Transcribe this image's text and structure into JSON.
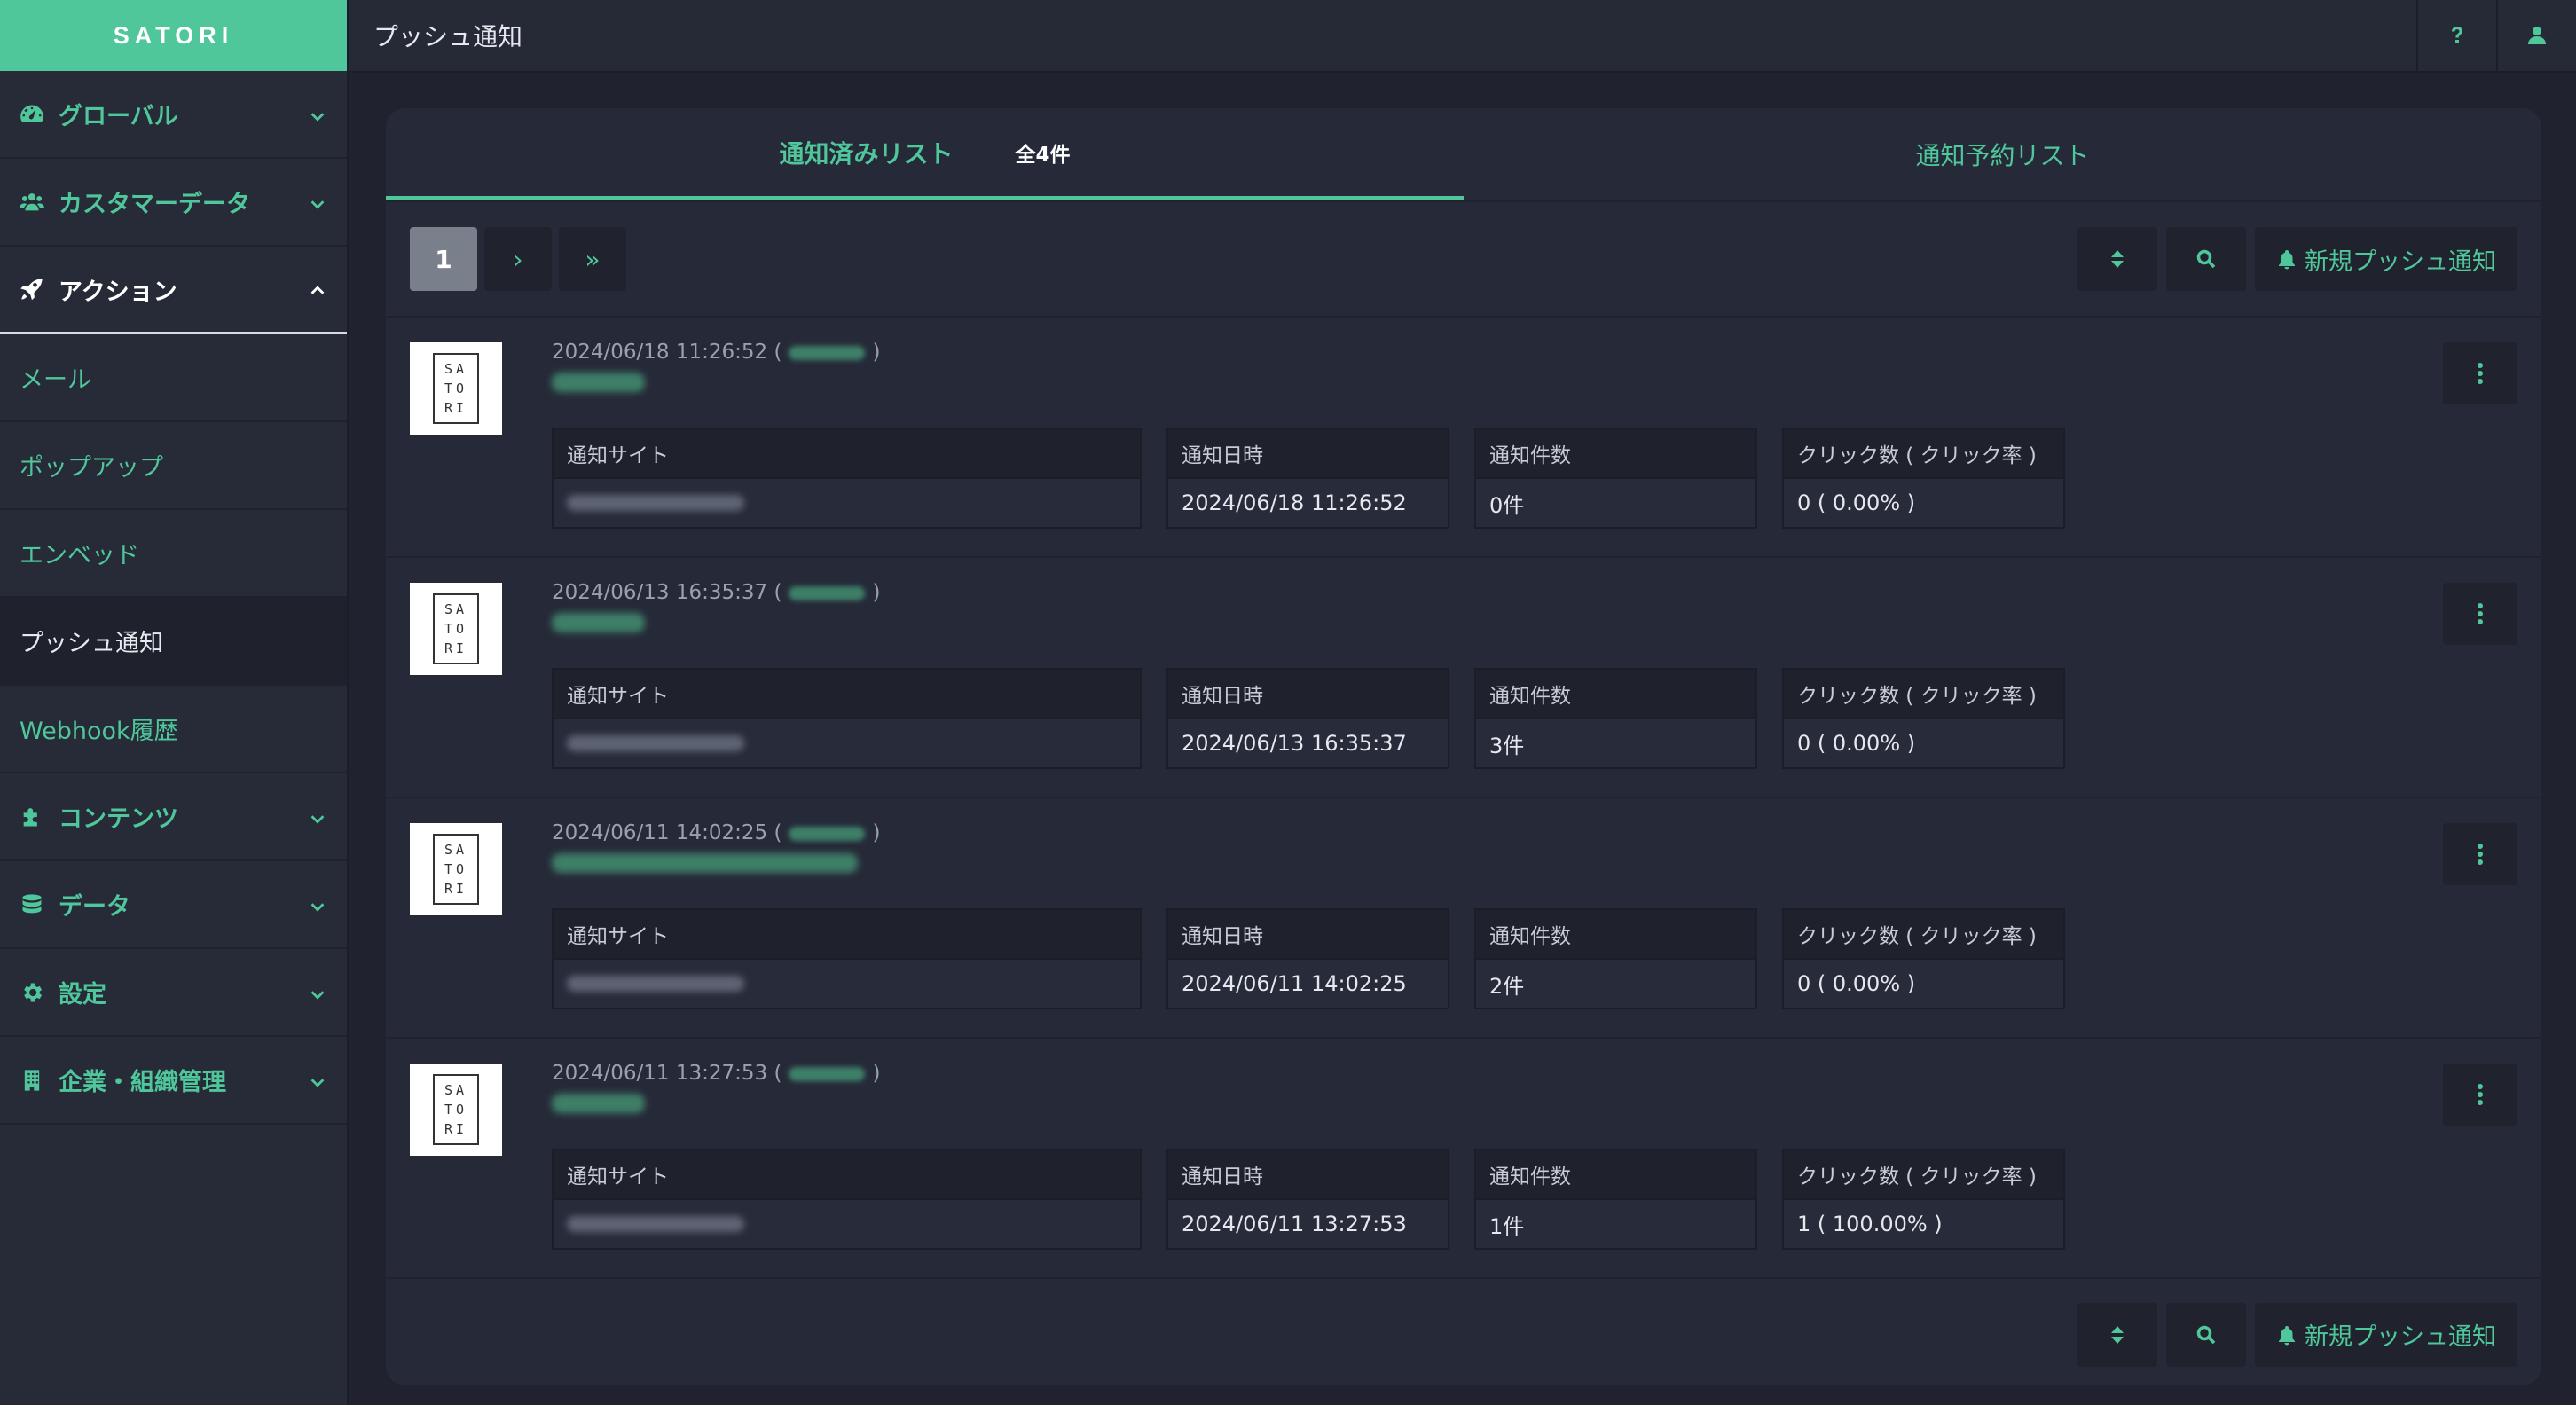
{
  "app": {
    "brand": "SATORI",
    "page_title": "プッシュ通知"
  },
  "sidebar": {
    "items": [
      {
        "key": "global",
        "label": "グローバル",
        "icon": "dashboard-icon"
      },
      {
        "key": "customer",
        "label": "カスタマーデータ",
        "icon": "users-icon"
      },
      {
        "key": "action",
        "label": "アクション",
        "icon": "rocket-icon",
        "open": true
      }
    ],
    "sub_items": [
      "メール",
      "ポップアップ",
      "エンベッド",
      "プッシュ通知",
      "Webhook履歴"
    ],
    "active_sub": "プッシュ通知",
    "more_items": [
      {
        "key": "contents",
        "label": "コンテンツ",
        "icon": "puzzle-icon"
      },
      {
        "key": "data",
        "label": "データ",
        "icon": "database-icon"
      },
      {
        "key": "settings",
        "label": "設定",
        "icon": "gear-icon"
      },
      {
        "key": "company",
        "label": "企業・組織管理",
        "icon": "building-icon"
      }
    ]
  },
  "topbar": {
    "help": "?",
    "help_icon": "question-icon",
    "user_icon": "user-icon"
  },
  "tabs": {
    "sent": {
      "label": "通知済みリスト",
      "count": "全4件"
    },
    "scheduled": {
      "label": "通知予約リスト"
    }
  },
  "pagination": {
    "current": "1",
    "next": "›",
    "last": "»"
  },
  "actions": {
    "new_push": "新規プッシュ通知",
    "sort_icon": "sort-icon",
    "search_icon": "search-icon",
    "bell_icon": "bell-icon"
  },
  "columns": {
    "site": "通知サイト",
    "date": "通知日時",
    "count": "通知件数",
    "clicks": "クリック数 ( クリック率 )"
  },
  "logo_letters": [
    "SA",
    "TO",
    "RI"
  ],
  "entries": [
    {
      "timestamp": "2024/06/18 11:26:52 (",
      "close": ")",
      "notified_at": "2024/06/18 11:26:52",
      "sent": "0件",
      "clicks": "0 ( 0.00% )"
    },
    {
      "timestamp": "2024/06/13 16:35:37 (",
      "close": ")",
      "notified_at": "2024/06/13 16:35:37",
      "sent": "3件",
      "clicks": "0 ( 0.00% )"
    },
    {
      "timestamp": "2024/06/11 14:02:25 (",
      "close": ")",
      "notified_at": "2024/06/11 14:02:25",
      "sent": "2件",
      "clicks": "0 ( 0.00% )"
    },
    {
      "timestamp": "2024/06/11 13:27:53 (",
      "close": ")",
      "notified_at": "2024/06/11 13:27:53",
      "sent": "1件",
      "clicks": "1 ( 100.00% )"
    }
  ],
  "colors": {
    "accent": "#4fc79b",
    "bg": "#20232f",
    "panel": "#262a38"
  }
}
